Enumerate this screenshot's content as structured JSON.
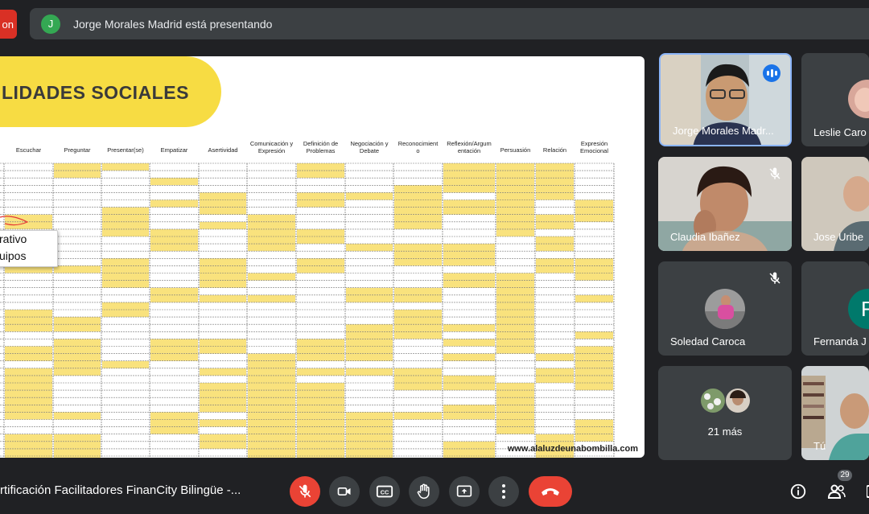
{
  "top": {
    "red_button_label": "on",
    "presenter_initial": "J",
    "presenting_text": "Jorge Morales Madrid está presentando"
  },
  "slide": {
    "title": "LIDADES SOCIALES",
    "columns": [
      "Escuchar",
      "Preguntar",
      "Presentar(se)",
      "Empatizar",
      "Asertividad",
      "Comunicación y Expresión",
      "Definición de Problemas",
      "Negociación y Debate",
      "Reconocimient o",
      "Reflexión/Argum entación",
      "Persuasión",
      "Relación",
      "Expresión Emocional"
    ],
    "callout_line1": "rativo",
    "callout_line2": "uipos",
    "footer_url": "www.alaluzdeunabombilla.com",
    "highlight_color": "#f9e27d"
  },
  "participants": [
    {
      "name": "Jorge Morales Madr...",
      "speaking": true
    },
    {
      "name": "Leslie Caro"
    },
    {
      "name": "Claudia Ibañez",
      "muted": true
    },
    {
      "name": "Jose Uribe"
    },
    {
      "name": "Soledad Caroca",
      "muted": true
    },
    {
      "name": "Fernanda J",
      "initial": "F"
    },
    {
      "name": "21 más"
    },
    {
      "name": "Tú"
    }
  ],
  "bottom": {
    "meeting_title": "rtificación Facilitadores FinanCity Bilingüe -...",
    "participant_count": "29"
  },
  "colors": {
    "accent_red": "#ea4335",
    "tile_bg": "#3c4043",
    "speaking_blue": "#1a73e8",
    "teal_avatar": "#00796b"
  }
}
